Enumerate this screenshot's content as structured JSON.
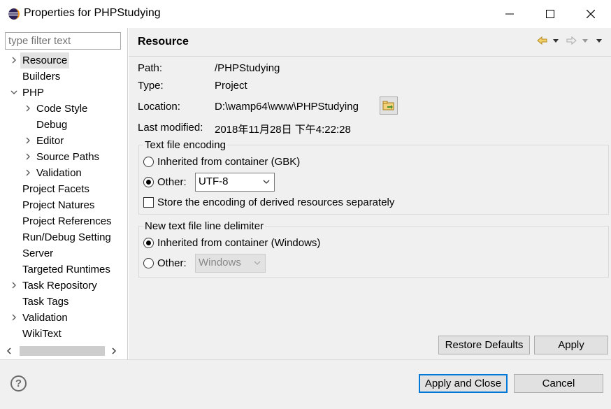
{
  "window": {
    "title": "Properties for PHPStudying",
    "icon": "eclipse-icon",
    "controls": [
      "minimize-icon",
      "maximize-icon",
      "close-icon"
    ]
  },
  "filter": {
    "placeholder": "type filter text",
    "value": ""
  },
  "tree": [
    {
      "label": "Resource",
      "selected": true,
      "arrow": "right"
    },
    {
      "label": "Builders"
    },
    {
      "label": "PHP",
      "arrow": "down"
    },
    {
      "label": "Code Style",
      "arrow": "right"
    },
    {
      "label": "Debug"
    },
    {
      "label": "Editor",
      "arrow": "right"
    },
    {
      "label": "Source Paths",
      "arrow": "right"
    },
    {
      "label": "Validation",
      "arrow": "right"
    },
    {
      "label": "Project Facets"
    },
    {
      "label": "Project Natures"
    },
    {
      "label": "Project References"
    },
    {
      "label": "Run/Debug Setting"
    },
    {
      "label": "Server"
    },
    {
      "label": "Targeted Runtimes"
    },
    {
      "label": "Task Repository",
      "arrow": "right"
    },
    {
      "label": "Task Tags"
    },
    {
      "label": "Validation",
      "arrow": "right"
    },
    {
      "label": "WikiText"
    }
  ],
  "resource": {
    "heading": "Resource",
    "path_label": "Path:",
    "path_value": "/PHPStudying",
    "type_label": "Type:",
    "type_value": "Project",
    "location_label": "Location:",
    "location_value": "D:\\wamp64\\www\\PHPStudying",
    "modified_label": "Last modified:",
    "modified_value": "2018年11月28日 下午4:22:28"
  },
  "encoding": {
    "group_title": "Text file encoding",
    "inherited_label": "Inherited from container (GBK)",
    "other_label": "Other:",
    "other_value": "UTF-8",
    "store_label": "Store the encoding of derived resources separately"
  },
  "delimiter": {
    "group_title": "New text file line delimiter",
    "inherited_label": "Inherited from container (Windows)",
    "other_label": "Other:",
    "other_value": "Windows"
  },
  "buttons": {
    "restore_defaults": "Restore Defaults",
    "apply": "Apply",
    "apply_and_close": "Apply and Close",
    "cancel": "Cancel"
  },
  "colors": {
    "accent": "#0078d7",
    "panel": "#f0f0f0"
  }
}
